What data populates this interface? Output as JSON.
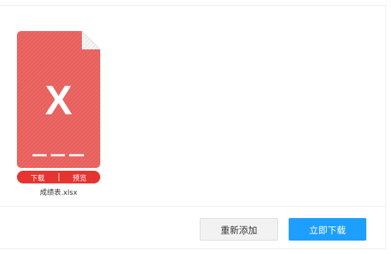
{
  "file": {
    "name": "成绩表.xlsx",
    "icon_letter": "X",
    "icon_color": "#e8605d",
    "download_label": "下载",
    "preview_label": "预览"
  },
  "footer": {
    "re_add_label": "重新添加",
    "download_now_label": "立即下载"
  },
  "colors": {
    "accent": "#1e9fff",
    "danger": "#e63431"
  }
}
